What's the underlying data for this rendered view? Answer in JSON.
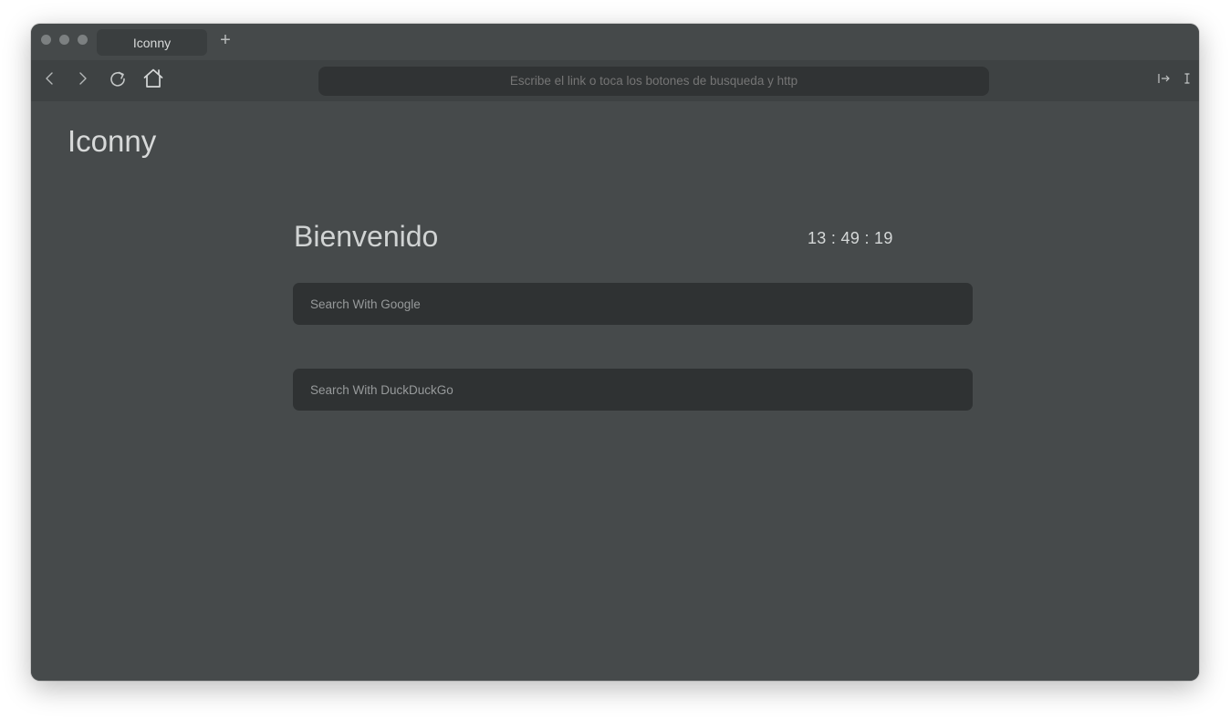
{
  "tab": {
    "title": "Iconny",
    "new_tab_label": "+"
  },
  "toolbar": {
    "url_placeholder": "Escribe el link o toca los botones de busqueda y http",
    "back_icon": "chevron-left-icon",
    "forward_icon": "chevron-right-icon",
    "reload_icon": "reload-icon",
    "home_icon": "home-icon",
    "enter_icon": "arrow-bar-right-icon",
    "cursor_icon": "text-cursor-icon"
  },
  "page": {
    "brand": "Iconny",
    "welcome": "Bienvenido",
    "clock": "13 : 49 : 19",
    "google_placeholder": "Search With Google",
    "duckduckgo_placeholder": "Search With DuckDuckGo"
  },
  "colors": {
    "background": "#464a4b",
    "toolbar": "#3e4243",
    "input": "#2f3233",
    "text": "#d7d9d9"
  }
}
